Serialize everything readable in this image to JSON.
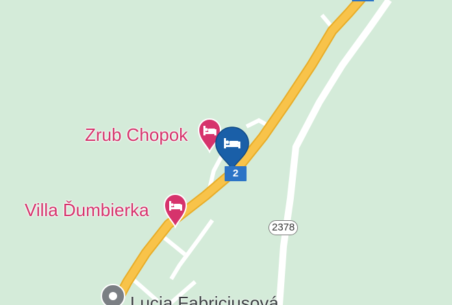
{
  "map": {
    "colors": {
      "land": "#d4ebd9",
      "main_road_fill": "#f8c34a",
      "main_road_casing": "#e8ad28",
      "minor_road": "#ffffff",
      "hotel_pin": "#d6336c",
      "selected_pin": "#1a5fa8",
      "route_shield": "#2c74c6",
      "place_pin": "#7b7f84"
    },
    "pois": [
      {
        "label": "Zrub Chopok",
        "icon": "bed-icon"
      },
      {
        "label": "Villa Ďumbierka",
        "icon": "bed-icon"
      }
    ],
    "selected_marker": {
      "icon": "bed-icon"
    },
    "route_shield": {
      "text": "2"
    },
    "road_badge": {
      "text": "2378"
    },
    "place": {
      "label": "Lucia Fabriciusová",
      "icon": "place-pin-icon"
    }
  }
}
